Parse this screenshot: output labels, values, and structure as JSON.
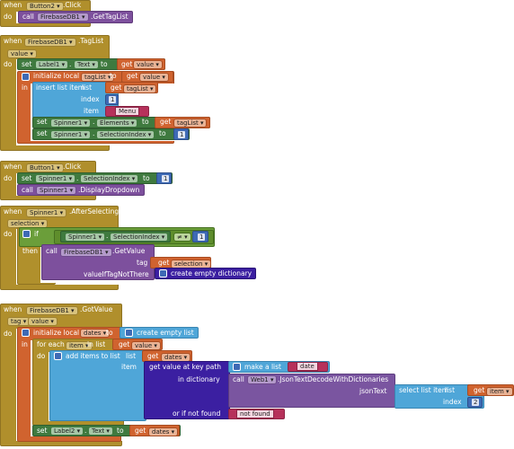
{
  "keywords": {
    "when": "when",
    "do": "do",
    "set": "set",
    "to": "to",
    "get": "get",
    "call": "call",
    "in": "in",
    "if": "if",
    "then": "then",
    "tag": "tag",
    "item": "item",
    "index": "index",
    "list": "list",
    "initialize_local": "initialize local",
    "insert_list_item": "insert list item",
    "for_each": "for each",
    "in_list": "in list",
    "add_items_to_list": "add items to list",
    "get_value_at_key_path": "get value at key path",
    "in_dictionary": "in dictionary",
    "or_if_not_found": "or if not found",
    "make_a_list": "make a list",
    "create_empty_list": "create empty list",
    "create_empty_dictionary": "create empty dictionary",
    "select_list_item": "select list item",
    "jsontext": "jsonText",
    "valueiftagnotthere": "valueIfTagNotThere"
  },
  "block1": {
    "component": "Button2",
    "event": ".Click",
    "call_component": "FirebaseDB1",
    "call_method": ".GetTagList"
  },
  "block2": {
    "component": "FirebaseDB1",
    "event": ".TagList",
    "param": "value",
    "set1_component": "Label1",
    "set1_prop": "Text",
    "set1_get": "value",
    "local_name": "tagList",
    "local_get": "value",
    "insert_list": "tagList",
    "insert_index": "1",
    "insert_item": "Menu",
    "set2_component": "Spinner1",
    "set2_prop": "Elements",
    "set2_get": "tagList",
    "set3_component": "Spinner1",
    "set3_prop": "SelectionIndex",
    "set3_value": "1"
  },
  "block3": {
    "component": "Button1",
    "event": ".Click",
    "set_component": "Spinner1",
    "set_prop": "SelectionIndex",
    "set_value": "1",
    "call_component": "Spinner1",
    "call_method": ".DisplayDropdown"
  },
  "block4": {
    "component": "Spinner1",
    "event": ".AfterSelecting",
    "param": "selection",
    "cmp_component": "Spinner1",
    "cmp_prop": "SelectionIndex",
    "cmp_op": "≠",
    "cmp_value": "1",
    "call_component": "FirebaseDB1",
    "call_method": ".GetValue",
    "tag_get": "selection"
  },
  "block5": {
    "component": "FirebaseDB1",
    "event": ".GotValue",
    "param1": "tag",
    "param2": "value",
    "local_name": "dates",
    "foreach_var": "item",
    "foreach_get": "value",
    "add_list_get": "dates",
    "make_list_item": "date",
    "web_component": "Web1",
    "web_method": ".JsonTextDecodeWithDictionaries",
    "select_get": "item",
    "select_index": "2",
    "not_found": "not found",
    "set_component": "Label2",
    "set_prop": "Text",
    "set_get": "dates"
  }
}
